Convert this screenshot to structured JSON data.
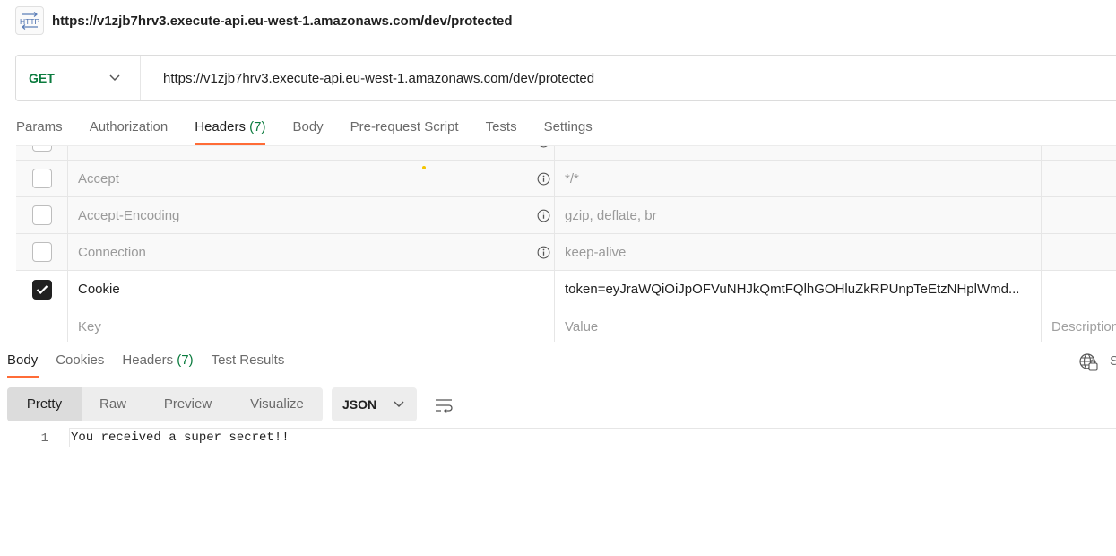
{
  "request": {
    "icon": "http-icon",
    "icon_text": "HTTP",
    "title": "https://v1zjb7hrv3.execute-api.eu-west-1.amazonaws.com/dev/protected",
    "method": "GET",
    "url": "https://v1zjb7hrv3.execute-api.eu-west-1.amazonaws.com/dev/protected"
  },
  "request_tabs": [
    {
      "label": "Params"
    },
    {
      "label": "Authorization"
    },
    {
      "label": "Headers",
      "count": "(7)",
      "active": true
    },
    {
      "label": "Body"
    },
    {
      "label": "Pre-request Script"
    },
    {
      "label": "Tests"
    },
    {
      "label": "Settings"
    }
  ],
  "headers": {
    "rows": [
      {
        "key": "Accept",
        "value": "*/*",
        "checked": false,
        "auto": true
      },
      {
        "key": "Accept-Encoding",
        "value": "gzip, deflate, br",
        "checked": false,
        "auto": true
      },
      {
        "key": "Connection",
        "value": "keep-alive",
        "checked": false,
        "auto": true
      },
      {
        "key": "Cookie",
        "value": "token=eyJraWQiOiJpOFVuNHJkQmtFQlhGOHluZkRPUnpTeEtzNHplWmd...",
        "checked": true,
        "auto": false
      }
    ],
    "placeholder": {
      "key": "Key",
      "value": "Value",
      "description": "Description"
    }
  },
  "response_tabs": [
    {
      "label": "Body",
      "active": true
    },
    {
      "label": "Cookies"
    },
    {
      "label": "Headers",
      "count": "(7)"
    },
    {
      "label": "Test Results"
    }
  ],
  "response_toolbar": {
    "globe_icon": "globe-icon",
    "save_hint": "S"
  },
  "view_modes": [
    {
      "label": "Pretty",
      "active": true
    },
    {
      "label": "Raw"
    },
    {
      "label": "Preview"
    },
    {
      "label": "Visualize"
    }
  ],
  "format": "JSON",
  "body_lines": [
    {
      "num": "1",
      "text": "You received a super secret!!"
    }
  ],
  "colors": {
    "accent": "#ff6c37",
    "method_green": "#0b7b3e",
    "checkbox_checked": "#212121"
  }
}
